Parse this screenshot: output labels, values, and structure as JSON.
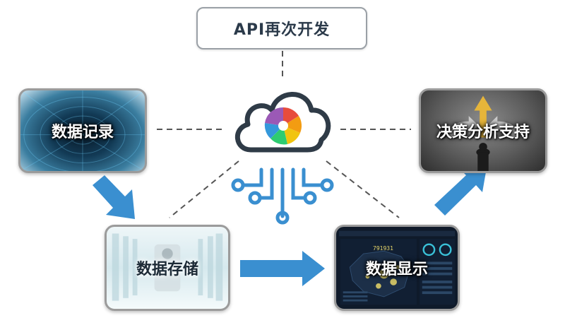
{
  "top": {
    "api_label": "API再次开发"
  },
  "cards": {
    "record": "数据记录",
    "storage": "数据存储",
    "display": "数据显示",
    "decision": "决策分析支持"
  },
  "display_card": {
    "headline_number": "791931"
  },
  "icons": [
    "cloud-icon",
    "rainbow-swirl-logo",
    "circuit-connector-icon",
    "arrow-icon"
  ],
  "colors": {
    "accent_blue": "#3a8fd0",
    "outline_dark": "#2f3b47",
    "dash": "#555555",
    "card_border": "#9b9b9b"
  }
}
